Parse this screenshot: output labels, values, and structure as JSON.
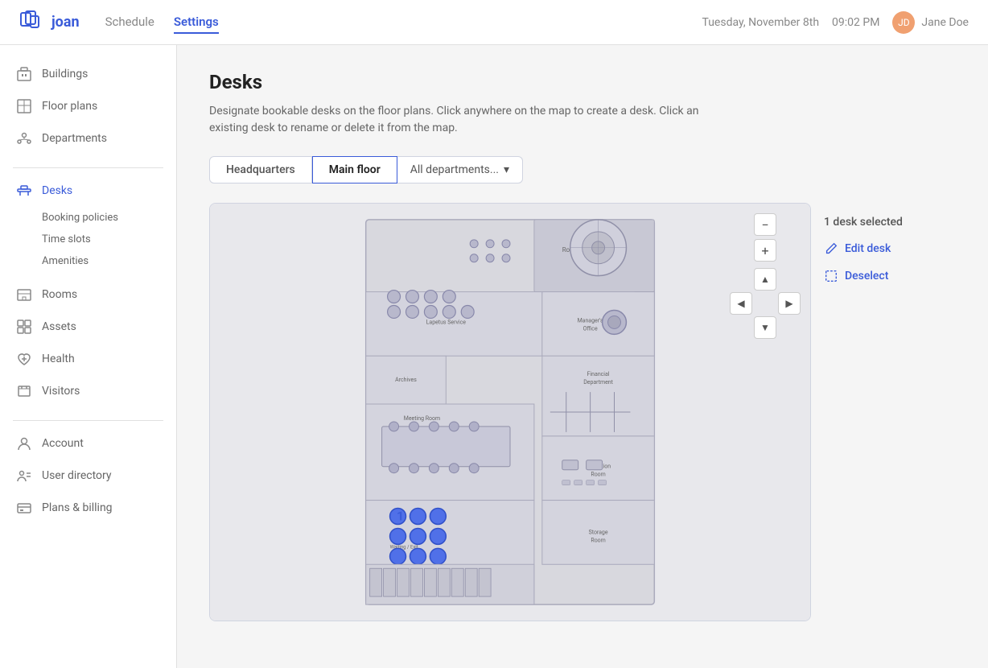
{
  "topnav": {
    "logo_text": "joan",
    "nav_items": [
      {
        "label": "Schedule",
        "active": false
      },
      {
        "label": "Settings",
        "active": true
      }
    ],
    "datetime": "Tuesday, November 8th",
    "time": "09:02 PM",
    "user": "Jane Doe"
  },
  "sidebar": {
    "main_items": [
      {
        "id": "buildings",
        "label": "Buildings",
        "icon": "buildings"
      },
      {
        "id": "floor-plans",
        "label": "Floor plans",
        "icon": "floor-plans"
      },
      {
        "id": "departments",
        "label": "Departments",
        "icon": "departments"
      }
    ],
    "desk_items": [
      {
        "id": "desks",
        "label": "Desks",
        "active": true,
        "icon": "desks"
      },
      {
        "id": "booking-policies",
        "label": "Booking policies",
        "sub": true
      },
      {
        "id": "time-slots",
        "label": "Time slots",
        "sub": true
      },
      {
        "id": "amenities",
        "label": "Amenities",
        "sub": true
      }
    ],
    "other_items": [
      {
        "id": "rooms",
        "label": "Rooms",
        "icon": "rooms"
      },
      {
        "id": "assets",
        "label": "Assets",
        "icon": "assets"
      },
      {
        "id": "health",
        "label": "Health",
        "icon": "health"
      },
      {
        "id": "visitors",
        "label": "Visitors",
        "icon": "visitors"
      }
    ],
    "bottom_items": [
      {
        "id": "account",
        "label": "Account",
        "icon": "account"
      },
      {
        "id": "user-directory",
        "label": "User directory",
        "icon": "user-directory"
      },
      {
        "id": "plans-billing",
        "label": "Plans & billing",
        "icon": "plans-billing"
      }
    ]
  },
  "page": {
    "title": "Desks",
    "description": "Designate bookable desks on the floor plans. Click anywhere on the map to create a desk. Click an existing desk to rename or delete it from the map."
  },
  "tabs": [
    {
      "label": "Headquarters",
      "active": false
    },
    {
      "label": "Main floor",
      "active": true
    },
    {
      "label": "All departments...",
      "active": false,
      "dropdown": true
    }
  ],
  "map": {
    "zoom_in": "+",
    "zoom_out": "−",
    "desk_number": "1"
  },
  "panel": {
    "selection_text": "1 desk selected",
    "edit_label": "Edit desk",
    "deselect_label": "Deselect"
  }
}
